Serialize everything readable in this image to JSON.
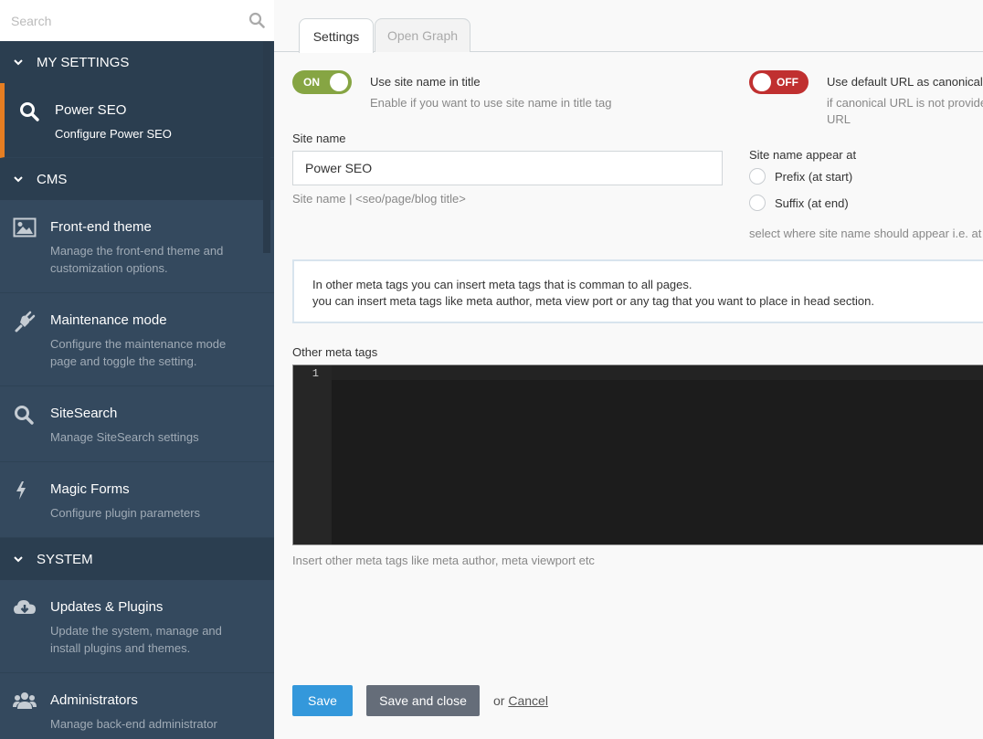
{
  "sidebar": {
    "search": {
      "placeholder": "Search",
      "value": ""
    },
    "sections": [
      {
        "label": "MY SETTINGS"
      },
      {
        "label": "CMS"
      },
      {
        "label": "SYSTEM"
      }
    ],
    "items": [
      {
        "icon": "search-icon",
        "title": "Power SEO",
        "desc": "Configure Power SEO"
      },
      {
        "icon": "image-icon",
        "title": "Front-end theme",
        "desc": "Manage the front-end theme and customization options."
      },
      {
        "icon": "plug-icon",
        "title": "Maintenance mode",
        "desc": "Configure the maintenance mode page and toggle the setting."
      },
      {
        "icon": "search-icon",
        "title": "SiteSearch",
        "desc": "Manage SiteSearch settings"
      },
      {
        "icon": "bolt-icon",
        "title": "Magic Forms",
        "desc": "Configure plugin parameters"
      },
      {
        "icon": "cloud-download-icon",
        "title": "Updates & Plugins",
        "desc": "Update the system, manage and install plugins and themes."
      },
      {
        "icon": "users-icon",
        "title": "Administrators",
        "desc": "Manage back-end administrator"
      }
    ],
    "accent_color": "#e67e22"
  },
  "tabs": [
    {
      "label": "Settings",
      "active": true
    },
    {
      "label": "Open Graph",
      "active": false
    }
  ],
  "form": {
    "site_name_toggle": {
      "state": "ON",
      "label": "Use site name in title",
      "help": "Enable if you want to use site name in title tag",
      "color": "#86a543"
    },
    "canonical_toggle": {
      "state": "OFF",
      "label": "Use default URL as canonical U",
      "help_line1": "if canonical URL is not provide",
      "help_line2": "URL",
      "color": "#c03030"
    },
    "site_name": {
      "label": "Site name",
      "value": "Power SEO",
      "help": "Site name | <seo/page/blog title>"
    },
    "site_name_position": {
      "label": "Site name appear at",
      "options": [
        "Prefix (at start)",
        "Suffix (at end)"
      ],
      "selected": null,
      "help": "select where site name should appear i.e. at s"
    },
    "info": {
      "line1": "In other meta tags you can insert meta tags that is comman to all pages.",
      "line2": "you can insert meta tags like meta author, meta view port or any tag that you want to place in head section."
    },
    "other_meta": {
      "label": "Other meta tags",
      "line_number": "1",
      "value": "",
      "help": "Insert other meta tags like meta author, meta viewport etc"
    }
  },
  "actions": {
    "save_label": "Save",
    "save_close_label": "Save and close",
    "or_text": "or",
    "cancel_label": "Cancel",
    "primary_color": "#3498db"
  }
}
